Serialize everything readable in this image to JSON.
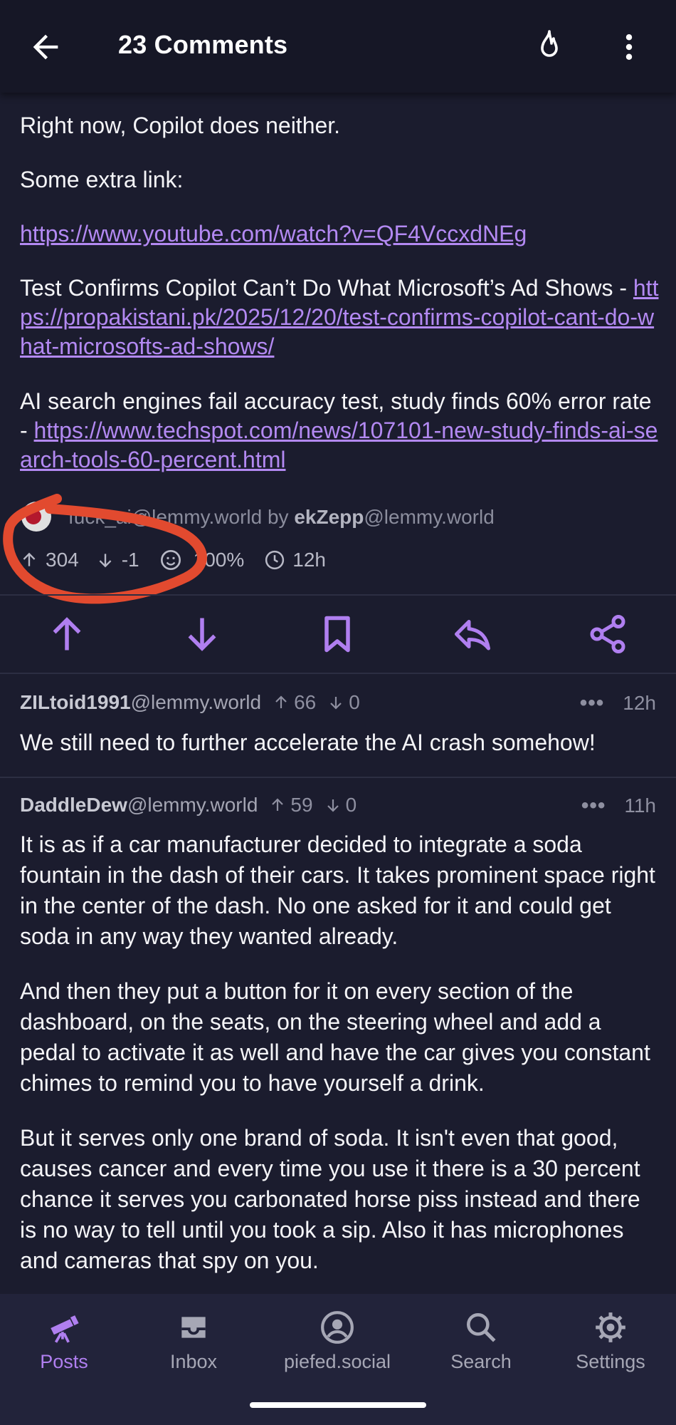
{
  "header": {
    "title": "23 Comments"
  },
  "post": {
    "line1": "Right now, Copilot does neither.",
    "line2": "Some extra link:",
    "youtube_link": "https://www.youtube.com/watch?v=QF4VccxdNEg",
    "test_text": "Test Confirms Copilot Can’t Do What Microsoft’s Ad Shows - ",
    "test_link": "https://propakistani.pk/2025/12/20/test-confirms-copilot-cant-do-what-microsofts-ad-shows/",
    "ai_text": "AI search engines fail accuracy test, study finds 60% error rate - ",
    "ai_link": "https://www.techspot.com/news/107101-new-study-finds-ai-search-tools-60-percent.html",
    "community": "fuck_ai",
    "community_instance": "@lemmy.world",
    "by": "by",
    "author": "ekZepp",
    "author_instance": "@lemmy.world",
    "upvotes": "304",
    "downvotes": "-1",
    "ratio": "100%",
    "age": "12h"
  },
  "comments": [
    {
      "user": "ZILtoid1991",
      "instance": "@lemmy.world",
      "up": "66",
      "down": "0",
      "age": "12h",
      "paragraphs": [
        "We still need to further accelerate the AI crash somehow!"
      ]
    },
    {
      "user": "DaddleDew",
      "instance": "@lemmy.world",
      "up": "59",
      "down": "0",
      "age": "11h",
      "paragraphs": [
        "It is as if a car manufacturer decided to integrate a soda fountain in the dash of their cars. It takes prominent space right in the center of the dash. No one asked for it and could get soda in any way they wanted already.",
        "And then they put a button for it on every section of the dashboard, on the seats, on the steering wheel and add a pedal to activate it as well and have the car gives you constant chimes to remind you to have yourself a drink.",
        "But it serves only one brand of soda. It isn't even that good, causes cancer and every time you use it there is a 30 percent chance it serves you carbonated horse piss instead and there is no way to tell until you took a sip. Also it has microphones and cameras that spy on you."
      ]
    }
  ],
  "nav": [
    {
      "label": "Posts",
      "icon": "telescope-icon",
      "active": true
    },
    {
      "label": "Inbox",
      "icon": "inbox-icon"
    },
    {
      "label": "piefed.social",
      "icon": "account-circle-icon"
    },
    {
      "label": "Search",
      "icon": "search-icon"
    },
    {
      "label": "Settings",
      "icon": "settings-icon"
    }
  ],
  "colors": {
    "accent": "#b07ff0",
    "background": "#1b1c2e",
    "annotation": "#e24a2f"
  }
}
